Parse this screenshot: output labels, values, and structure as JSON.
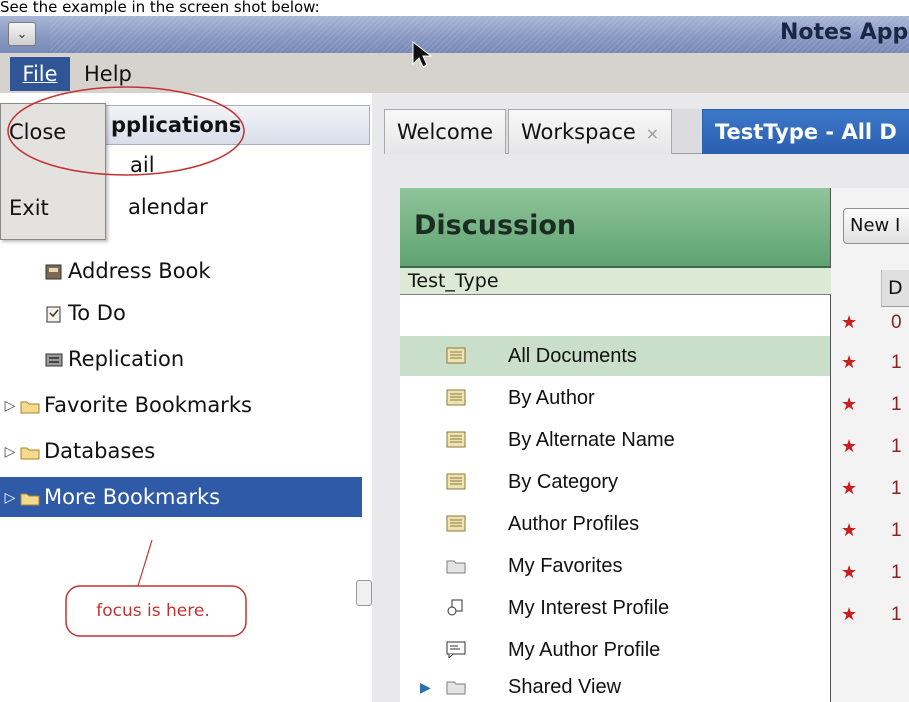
{
  "caption": "See the example in the screen shot below:",
  "window": {
    "title": "Notes Appl",
    "sysmenu_icon": "chevron-down-icon"
  },
  "menubar": {
    "file": "File",
    "help": "Help"
  },
  "file_menu": {
    "items": [
      "Close",
      "Exit"
    ]
  },
  "nav": {
    "header": "pplications",
    "items": [
      {
        "label": "ail",
        "icon": "mail-icon"
      },
      {
        "label": "alendar",
        "icon": "calendar-icon"
      },
      {
        "label": "Address Book",
        "icon": "address-book-icon"
      },
      {
        "label": "To Do",
        "icon": "todo-icon"
      },
      {
        "label": "Replication",
        "icon": "replication-icon"
      },
      {
        "label": "Favorite Bookmarks",
        "icon": "folder-icon"
      },
      {
        "label": "Databases",
        "icon": "folder-icon"
      },
      {
        "label": "More Bookmarks",
        "icon": "folder-icon"
      }
    ]
  },
  "annotation": {
    "callout": "focus is here.",
    "color": "#c23333"
  },
  "tabs": [
    {
      "label": "Welcome"
    },
    {
      "label": "Workspace",
      "close": "×"
    },
    {
      "label": "TestType - All D"
    }
  ],
  "discussion": {
    "title": "Discussion",
    "db_name": "Test_Type",
    "views": [
      {
        "label": "All Documents",
        "icon": "view-icon"
      },
      {
        "label": "By Author",
        "icon": "view-icon"
      },
      {
        "label": "By Alternate Name",
        "icon": "view-icon"
      },
      {
        "label": "By Category",
        "icon": "view-icon"
      },
      {
        "label": "Author Profiles",
        "icon": "view-icon"
      },
      {
        "label": "My Favorites",
        "icon": "folder-icon"
      },
      {
        "label": "My Interest Profile",
        "icon": "interest-profile-icon"
      },
      {
        "label": "My Author Profile",
        "icon": "author-profile-icon"
      },
      {
        "label": "Shared View",
        "icon": "folder-icon"
      }
    ]
  },
  "docs": {
    "new_button": "New I",
    "column_header": "D",
    "rows": [
      "0",
      "1",
      "1",
      "1",
      "1",
      "1",
      "1",
      "1"
    ],
    "star_color": "#c81e1e"
  },
  "colors": {
    "selection": "#2f5aa8",
    "discussion_header": "#5fa371",
    "active_tab": "#2b5fb0"
  }
}
